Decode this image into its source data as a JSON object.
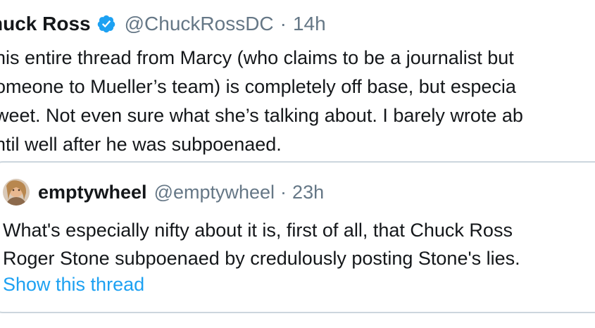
{
  "tweet": {
    "display_name": "huck Ross",
    "handle": "@ChuckRossDC",
    "separator": "·",
    "time": "14h",
    "body_lines": [
      "his entire thread from Marcy (who claims to be a journalist but",
      "omeone to Mueller’s team) is completely off base, but especia",
      "weet. Not even sure what she’s talking about. I barely wrote ab",
      "ntil well after he was subpoenaed."
    ]
  },
  "quoted_tweet": {
    "display_name": "emptywheel",
    "handle": "@emptywheel",
    "separator": "·",
    "time": "23h",
    "body_lines": [
      "What's especially nifty about it is, first of all, that Chuck Ross",
      "Roger Stone subpoenaed by credulously posting Stone's lies."
    ],
    "show_thread_label": "Show this thread"
  },
  "icons": {
    "verified": "verified-badge-icon",
    "avatar": "avatar"
  },
  "colors": {
    "text_primary": "#14171a",
    "text_secondary": "#657786",
    "link_blue": "#1da1f2",
    "border": "#ccd6dd"
  }
}
